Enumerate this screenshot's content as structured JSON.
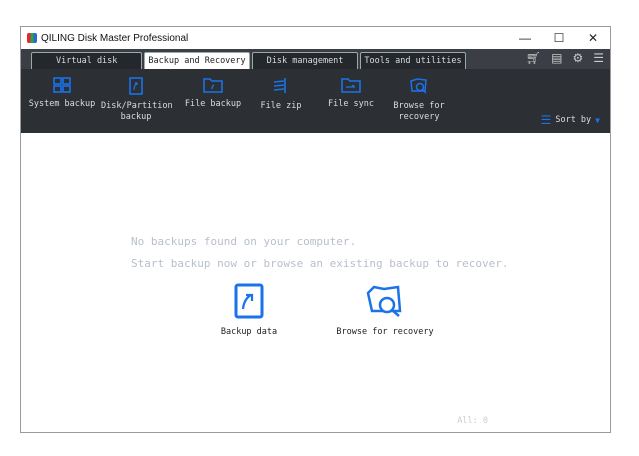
{
  "window": {
    "title": "QILING Disk Master Professional",
    "minimize": "—",
    "maximize": "☐",
    "close": "✕"
  },
  "tabs": [
    {
      "label": "Virtual disk"
    },
    {
      "label": "Backup and Recovery",
      "active": true
    },
    {
      "label": "Disk management"
    },
    {
      "label": "Tools and utilities"
    }
  ],
  "tab_icons": [
    "cart-icon",
    "notes-icon",
    "gear-icon",
    "menu-icon"
  ],
  "toolbar": {
    "items": [
      {
        "label": "System backup"
      },
      {
        "label": "Disk/Partition backup"
      },
      {
        "label": "File backup"
      },
      {
        "label": "File zip"
      },
      {
        "label": "File sync"
      },
      {
        "label": "Browse for recovery"
      }
    ],
    "sort_label": "Sort by"
  },
  "main": {
    "empty_line1": "No backups found on your computer.",
    "empty_line2": "Start backup now or browse an existing backup to recover.",
    "backup_data": "Backup data",
    "browse_recovery": "Browse for recovery",
    "count": "All: 0"
  },
  "colors": {
    "accent": "#1a73e8",
    "toolbar_bg": "#2c2f34",
    "hint_text": "#b8bfcc"
  }
}
